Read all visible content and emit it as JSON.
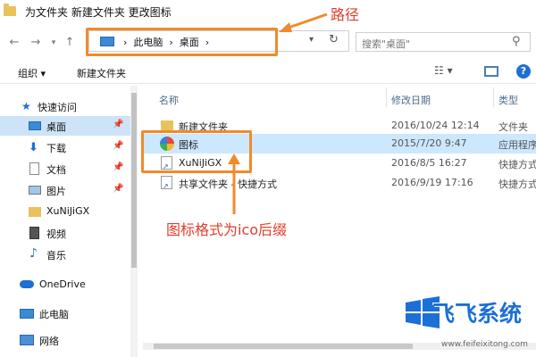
{
  "window": {
    "title": "为文件夹 新建文件夹 更改图标"
  },
  "nav": {
    "back_icon": "back-arrow",
    "forward_icon": "forward-arrow",
    "recent_icon": "chevron-down",
    "up_icon": "up-arrow",
    "address_path": "›  此电脑  ›  桌面  ›",
    "refresh_icon": "refresh",
    "search_placeholder": "搜索\"桌面\""
  },
  "toolbar": {
    "organize_label": "组织 ▾",
    "new_folder_label": "新建文件夹",
    "view_icon": "view-options",
    "help_label": "?"
  },
  "sidebar": {
    "items": [
      {
        "label": "快速访问",
        "icon": "star"
      },
      {
        "label": "桌面",
        "icon": "desktop",
        "selected": true,
        "pinned": true
      },
      {
        "label": "下载",
        "icon": "download",
        "pinned": true
      },
      {
        "label": "文档",
        "icon": "documents",
        "pinned": true
      },
      {
        "label": "图片",
        "icon": "pictures",
        "pinned": true
      },
      {
        "label": "XuNiJiGX",
        "icon": "folder"
      },
      {
        "label": "视频",
        "icon": "video"
      },
      {
        "label": "音乐",
        "icon": "music"
      },
      {
        "label": "OneDrive",
        "icon": "cloud"
      },
      {
        "label": "此电脑",
        "icon": "computer"
      },
      {
        "label": "网络",
        "icon": "network"
      }
    ]
  },
  "columns": [
    "名称",
    "修改日期",
    "类型"
  ],
  "files": [
    {
      "name": "新建文件夹",
      "date": "2016/10/24 12:14",
      "type": "文件夹",
      "icon": "folder"
    },
    {
      "name": "图标",
      "date": "2015/7/20 9:47",
      "type": "应用程序",
      "icon": "app",
      "selected": true
    },
    {
      "name": "XuNiJiGX",
      "date": "2016/8/5 16:27",
      "type": "快捷方式",
      "icon": "shortcut"
    },
    {
      "name": "共享文件夹 - 快捷方式",
      "date": "2016/9/19 17:16",
      "type": "快捷方式",
      "icon": "shortcut"
    }
  ],
  "annotations": {
    "path_label": "路径",
    "icon_label": "图标格式为ico后缀",
    "color": "#f08a2c"
  },
  "watermark": {
    "brand": "飞飞系统",
    "url": "www.feifeixitong.com",
    "color": "#1c6fd6"
  }
}
